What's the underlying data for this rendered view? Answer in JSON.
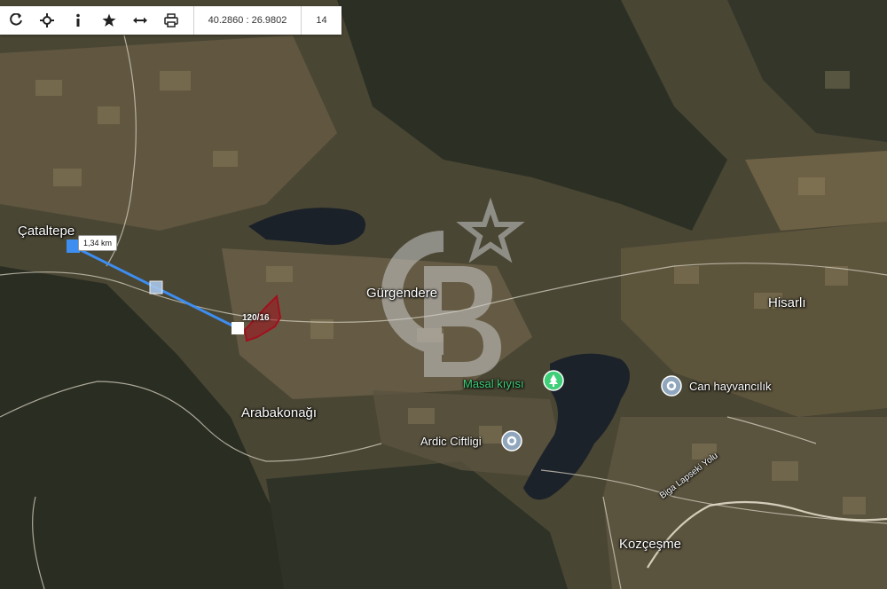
{
  "toolbar": {
    "buttons": [
      {
        "name": "refresh-button",
        "icon": "refresh-icon"
      },
      {
        "name": "center-button",
        "icon": "crosshair-icon"
      },
      {
        "name": "info-button",
        "icon": "info-icon"
      },
      {
        "name": "favorite-button",
        "icon": "star-icon"
      },
      {
        "name": "measure-button",
        "icon": "measure-icon"
      },
      {
        "name": "print-button",
        "icon": "print-icon"
      }
    ],
    "coordinates": "40.2860 : 26.9802",
    "zoom": "14"
  },
  "map": {
    "places": [
      {
        "name": "place-cataltepe",
        "text": "Çataltepe"
      },
      {
        "name": "place-gurgendere",
        "text": "Gürgendere"
      },
      {
        "name": "place-hisarli",
        "text": "Hisarlı"
      },
      {
        "name": "place-arabakonagi",
        "text": "Arabakonağı"
      },
      {
        "name": "place-kozcesme",
        "text": "Kozçeşme"
      }
    ],
    "pois": [
      {
        "name": "poi-masal-kiyisi",
        "text": "Masal kıyısı"
      },
      {
        "name": "poi-can-hayvancilik",
        "text": "Can hayvancılık"
      },
      {
        "name": "poi-ardic-ciftligi",
        "text": "Ardic Ciftligi"
      }
    ],
    "road_label": "Biga Lapseki Yolu",
    "measure_distance": "1,34 km",
    "parcel_label": "120/16",
    "colors": {
      "measure_line": "#3d8ef0",
      "parcel": "#a0101e",
      "poi_green": "#3fcf78",
      "poi_blue": "#8fa6bd"
    }
  }
}
